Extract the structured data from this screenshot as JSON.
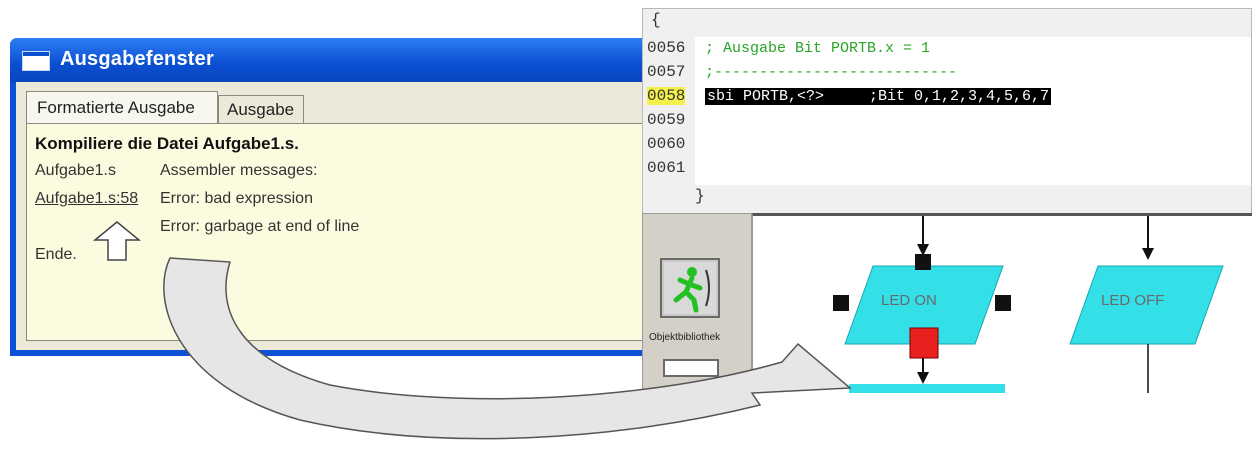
{
  "window": {
    "title": "Ausgabefenster",
    "tabs": [
      {
        "label": "Formatierte Ausgabe",
        "active": true
      },
      {
        "label": "Ausgabe",
        "active": false
      }
    ],
    "output": {
      "compile_line": "Kompiliere die Datei Aufgabe1.s.",
      "file_name": "Aufgabe1.s",
      "assembler_messages": "Assembler messages:",
      "error_link": "Aufgabe1.s:58",
      "error1": "Error: bad expression",
      "error2": "Error: garbage at end of line",
      "end": "Ende."
    }
  },
  "editor": {
    "brace_open": "{",
    "brace_close": "}",
    "lines": [
      {
        "number": "0056",
        "code": "; Ausgabe Bit PORTB.x = 1",
        "style": "comment",
        "highlight": false
      },
      {
        "number": "0057",
        "code": ";---------------------------",
        "style": "comment",
        "highlight": false
      },
      {
        "number": "0058",
        "code": "sbi PORTB,<?>     ;Bit 0,1,2,3,4,5,6,7",
        "style": "selected",
        "highlight": true
      },
      {
        "number": "0059",
        "code": "",
        "style": "plain",
        "highlight": false
      },
      {
        "number": "0060",
        "code": "",
        "style": "plain",
        "highlight": false
      },
      {
        "number": "0061",
        "code": "",
        "style": "plain",
        "highlight": false
      }
    ]
  },
  "library": {
    "label": "Objektbibliothek",
    "icon": "running-man-icon"
  },
  "flowchart": {
    "blocks": [
      {
        "label": "LED ON",
        "selected": true
      },
      {
        "label": "LED OFF",
        "selected": false
      }
    ]
  },
  "colors": {
    "titlebar": "#0a4fd1",
    "panel_bg": "#fbfbe0",
    "comment": "#28a628",
    "line_highlight": "#f6f04a",
    "flow_block": "#33e0e8",
    "handle_red": "#e8201e"
  }
}
